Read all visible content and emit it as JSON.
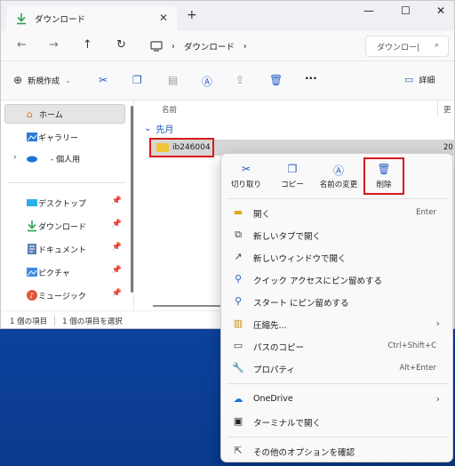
{
  "window": {
    "tab_title": "ダウンロード",
    "tab_close": "✕",
    "new_tab": "+",
    "minimize": "—",
    "maximize": "☐",
    "close": "✕"
  },
  "address": {
    "segments": [
      "ダウンロード"
    ],
    "separator": "›",
    "search_placeholder": "ダウンロー|"
  },
  "commandbar": {
    "new_label": "新規作成",
    "details_label": "詳細",
    "more": "···"
  },
  "sidebar": {
    "items": [
      {
        "label": "ホーム",
        "icon": "home-icon"
      },
      {
        "label": "ギャラリー",
        "icon": "gallery-icon"
      },
      {
        "label": "- 個人用",
        "icon": "onedrive-icon"
      },
      {
        "label": "デスクトップ",
        "icon": "desktop-icon"
      },
      {
        "label": "ダウンロード",
        "icon": "download-icon"
      },
      {
        "label": "ドキュメント",
        "icon": "documents-icon"
      },
      {
        "label": "ピクチャ",
        "icon": "pictures-icon"
      },
      {
        "label": "ミュージック",
        "icon": "music-icon"
      }
    ]
  },
  "content": {
    "column_name": "名前",
    "column_updated": "更",
    "group_label": "先月",
    "file_name": "ib246004",
    "file_date_partial": "20"
  },
  "status": {
    "count": "1 個の項目",
    "selected": "1 個の項目を選択"
  },
  "context_menu": {
    "quick": [
      {
        "label": "切り取り",
        "icon": "cut-icon"
      },
      {
        "label": "コピー",
        "icon": "copy-icon"
      },
      {
        "label": "名前の変更",
        "icon": "rename-icon"
      },
      {
        "label": "削除",
        "icon": "delete-icon"
      }
    ],
    "items": [
      {
        "label": "開く",
        "shortcut": "Enter",
        "icon": "open-folder-icon"
      },
      {
        "label": "新しいタブで開く",
        "shortcut": "",
        "icon": "new-tab-icon"
      },
      {
        "label": "新しいウィンドウで開く",
        "shortcut": "",
        "icon": "new-window-icon"
      },
      {
        "label": "クイック アクセスにピン留めする",
        "shortcut": "",
        "icon": "pin-icon"
      },
      {
        "label": "スタート にピン留めする",
        "shortcut": "",
        "icon": "pin-start-icon"
      },
      {
        "label": "圧縮先...",
        "shortcut": "",
        "icon": "zip-icon"
      },
      {
        "label": "パスのコピー",
        "shortcut": "Ctrl+Shift+C",
        "icon": "copy-path-icon"
      },
      {
        "label": "プロパティ",
        "shortcut": "Alt+Enter",
        "icon": "properties-icon"
      },
      {
        "label": "OneDrive",
        "shortcut": "",
        "icon": "onedrive-icon"
      },
      {
        "label": "ターミナルで開く",
        "shortcut": "",
        "icon": "terminal-icon"
      },
      {
        "label": "その他のオプションを確認",
        "shortcut": "",
        "icon": "more-options-icon"
      }
    ],
    "submenu_arrow": "›"
  },
  "colors": {
    "accent": "#2a5ec2",
    "highlight_box": "#d81b1b",
    "folder": "#f2c23a"
  }
}
